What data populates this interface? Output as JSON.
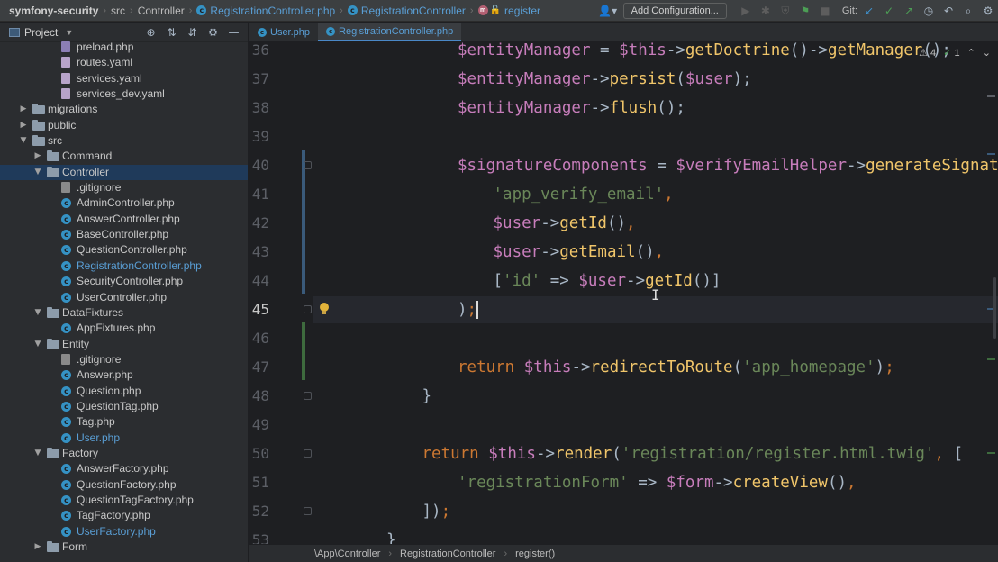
{
  "nav": {
    "project": "symfony-security",
    "crumbs": [
      "src",
      "Controller",
      "RegistrationController.php",
      "RegistrationController",
      "register"
    ]
  },
  "toolbar": {
    "add_configuration": "Add Configuration...",
    "git_label": "Git:"
  },
  "side_panel": {
    "title": "Project",
    "tree": [
      {
        "label": "preload.php",
        "kind": "php"
      },
      {
        "label": "routes.yaml",
        "kind": "yaml"
      },
      {
        "label": "services.yaml",
        "kind": "yaml"
      },
      {
        "label": "services_dev.yaml",
        "kind": "yaml"
      },
      {
        "label": "migrations",
        "kind": "folder",
        "state": "collapsed"
      },
      {
        "label": "public",
        "kind": "folder",
        "state": "collapsed"
      },
      {
        "label": "src",
        "kind": "folder",
        "state": "expanded"
      },
      {
        "label": "Command",
        "kind": "folder",
        "state": "collapsed"
      },
      {
        "label": "Controller",
        "kind": "folder",
        "state": "expanded",
        "selected": true
      },
      {
        "label": ".gitignore",
        "kind": "git"
      },
      {
        "label": "AdminController.php",
        "kind": "class"
      },
      {
        "label": "AnswerController.php",
        "kind": "class"
      },
      {
        "label": "BaseController.php",
        "kind": "class"
      },
      {
        "label": "QuestionController.php",
        "kind": "class"
      },
      {
        "label": "RegistrationController.php",
        "kind": "class",
        "modified": true
      },
      {
        "label": "SecurityController.php",
        "kind": "class"
      },
      {
        "label": "UserController.php",
        "kind": "class"
      },
      {
        "label": "DataFixtures",
        "kind": "folder",
        "state": "expanded"
      },
      {
        "label": "AppFixtures.php",
        "kind": "class"
      },
      {
        "label": "Entity",
        "kind": "folder",
        "state": "expanded"
      },
      {
        "label": ".gitignore",
        "kind": "git"
      },
      {
        "label": "Answer.php",
        "kind": "class"
      },
      {
        "label": "Question.php",
        "kind": "class"
      },
      {
        "label": "QuestionTag.php",
        "kind": "class"
      },
      {
        "label": "Tag.php",
        "kind": "class"
      },
      {
        "label": "User.php",
        "kind": "class",
        "modified": true
      },
      {
        "label": "Factory",
        "kind": "folder",
        "state": "expanded"
      },
      {
        "label": "AnswerFactory.php",
        "kind": "class"
      },
      {
        "label": "QuestionFactory.php",
        "kind": "class"
      },
      {
        "label": "QuestionTagFactory.php",
        "kind": "class"
      },
      {
        "label": "TagFactory.php",
        "kind": "class"
      },
      {
        "label": "UserFactory.php",
        "kind": "class",
        "modified": true
      },
      {
        "label": "Form",
        "kind": "folder",
        "state": "collapsed"
      }
    ]
  },
  "tabs": [
    {
      "label": "User.php",
      "active": false
    },
    {
      "label": "RegistrationController.php",
      "active": true
    }
  ],
  "editor": {
    "inspections": {
      "warnings": "4",
      "ok": "1"
    },
    "current_line": "45",
    "lines": [
      {
        "num": "36",
        "indent": 4,
        "tokens": [
          [
            "v",
            "$entityManager"
          ],
          [
            "o",
            " = "
          ],
          [
            "v",
            "$this"
          ],
          [
            "o",
            "->"
          ],
          [
            "f",
            "getDoctrine"
          ],
          [
            "p",
            "()"
          ],
          [
            "o",
            "->"
          ],
          [
            "f",
            "getManager"
          ],
          [
            "p",
            "();"
          ]
        ]
      },
      {
        "num": "37",
        "indent": 4,
        "tokens": [
          [
            "v",
            "$entityManager"
          ],
          [
            "o",
            "->"
          ],
          [
            "f",
            "persist"
          ],
          [
            "p",
            "("
          ],
          [
            "v",
            "$user"
          ],
          [
            "p",
            ");"
          ]
        ]
      },
      {
        "num": "38",
        "indent": 4,
        "tokens": [
          [
            "v",
            "$entityManager"
          ],
          [
            "o",
            "->"
          ],
          [
            "f",
            "flush"
          ],
          [
            "p",
            "();"
          ]
        ]
      },
      {
        "num": "39",
        "indent": 0,
        "tokens": []
      },
      {
        "num": "40",
        "indent": 4,
        "tokens": [
          [
            "v",
            "$signatureComponents"
          ],
          [
            "o",
            " = "
          ],
          [
            "v",
            "$verifyEmailHelper"
          ],
          [
            "o",
            "->"
          ],
          [
            "f",
            "generateSignature"
          ],
          [
            "p",
            "("
          ]
        ]
      },
      {
        "num": "41",
        "indent": 5,
        "tokens": [
          [
            "s",
            "'app_verify_email'"
          ],
          [
            "k",
            ","
          ]
        ]
      },
      {
        "num": "42",
        "indent": 5,
        "tokens": [
          [
            "v",
            "$user"
          ],
          [
            "o",
            "->"
          ],
          [
            "f",
            "getId"
          ],
          [
            "p",
            "()"
          ],
          [
            "k",
            ","
          ]
        ]
      },
      {
        "num": "43",
        "indent": 5,
        "tokens": [
          [
            "v",
            "$user"
          ],
          [
            "o",
            "->"
          ],
          [
            "f",
            "getEmail"
          ],
          [
            "p",
            "()"
          ],
          [
            "k",
            ","
          ]
        ]
      },
      {
        "num": "44",
        "indent": 5,
        "tokens": [
          [
            "p",
            "["
          ],
          [
            "s",
            "'id'"
          ],
          [
            "o",
            " => "
          ],
          [
            "v",
            "$user"
          ],
          [
            "o",
            "->"
          ],
          [
            "f",
            "getId"
          ],
          [
            "p",
            "()]"
          ]
        ]
      },
      {
        "num": "45",
        "indent": 4,
        "tokens": [
          [
            "p",
            ")"
          ],
          [
            "k",
            ";"
          ]
        ]
      },
      {
        "num": "46",
        "indent": 0,
        "tokens": []
      },
      {
        "num": "47",
        "indent": 4,
        "tokens": [
          [
            "k",
            "return "
          ],
          [
            "v",
            "$this"
          ],
          [
            "o",
            "->"
          ],
          [
            "f",
            "redirectToRoute"
          ],
          [
            "p",
            "("
          ],
          [
            "s",
            "'app_homepage'"
          ],
          [
            "p",
            ")"
          ],
          [
            "k",
            ";"
          ]
        ]
      },
      {
        "num": "48",
        "indent": 3,
        "tokens": [
          [
            "p",
            "}"
          ]
        ]
      },
      {
        "num": "49",
        "indent": 0,
        "tokens": []
      },
      {
        "num": "50",
        "indent": 3,
        "tokens": [
          [
            "k",
            "return "
          ],
          [
            "v",
            "$this"
          ],
          [
            "o",
            "->"
          ],
          [
            "f",
            "render"
          ],
          [
            "p",
            "("
          ],
          [
            "s",
            "'registration/register.html.twig'"
          ],
          [
            "k",
            ", "
          ],
          [
            "p",
            "["
          ]
        ]
      },
      {
        "num": "51",
        "indent": 4,
        "tokens": [
          [
            "s",
            "'registrationForm'"
          ],
          [
            "o",
            " => "
          ],
          [
            "v",
            "$form"
          ],
          [
            "o",
            "->"
          ],
          [
            "f",
            "createView"
          ],
          [
            "p",
            "()"
          ],
          [
            "k",
            ","
          ]
        ]
      },
      {
        "num": "52",
        "indent": 3,
        "tokens": [
          [
            "p",
            "])"
          ],
          [
            "k",
            ";"
          ]
        ]
      },
      {
        "num": "53",
        "indent": 2,
        "tokens": [
          [
            "p",
            "}"
          ]
        ]
      }
    ]
  },
  "status_breadcrumb": [
    "\\App\\Controller",
    "RegistrationController",
    "register()"
  ],
  "colors": {
    "variable": "#c77dbb",
    "function": "#f0c56a",
    "string": "#6a8759",
    "keyword": "#cc7832",
    "accent": "#3592c4"
  }
}
